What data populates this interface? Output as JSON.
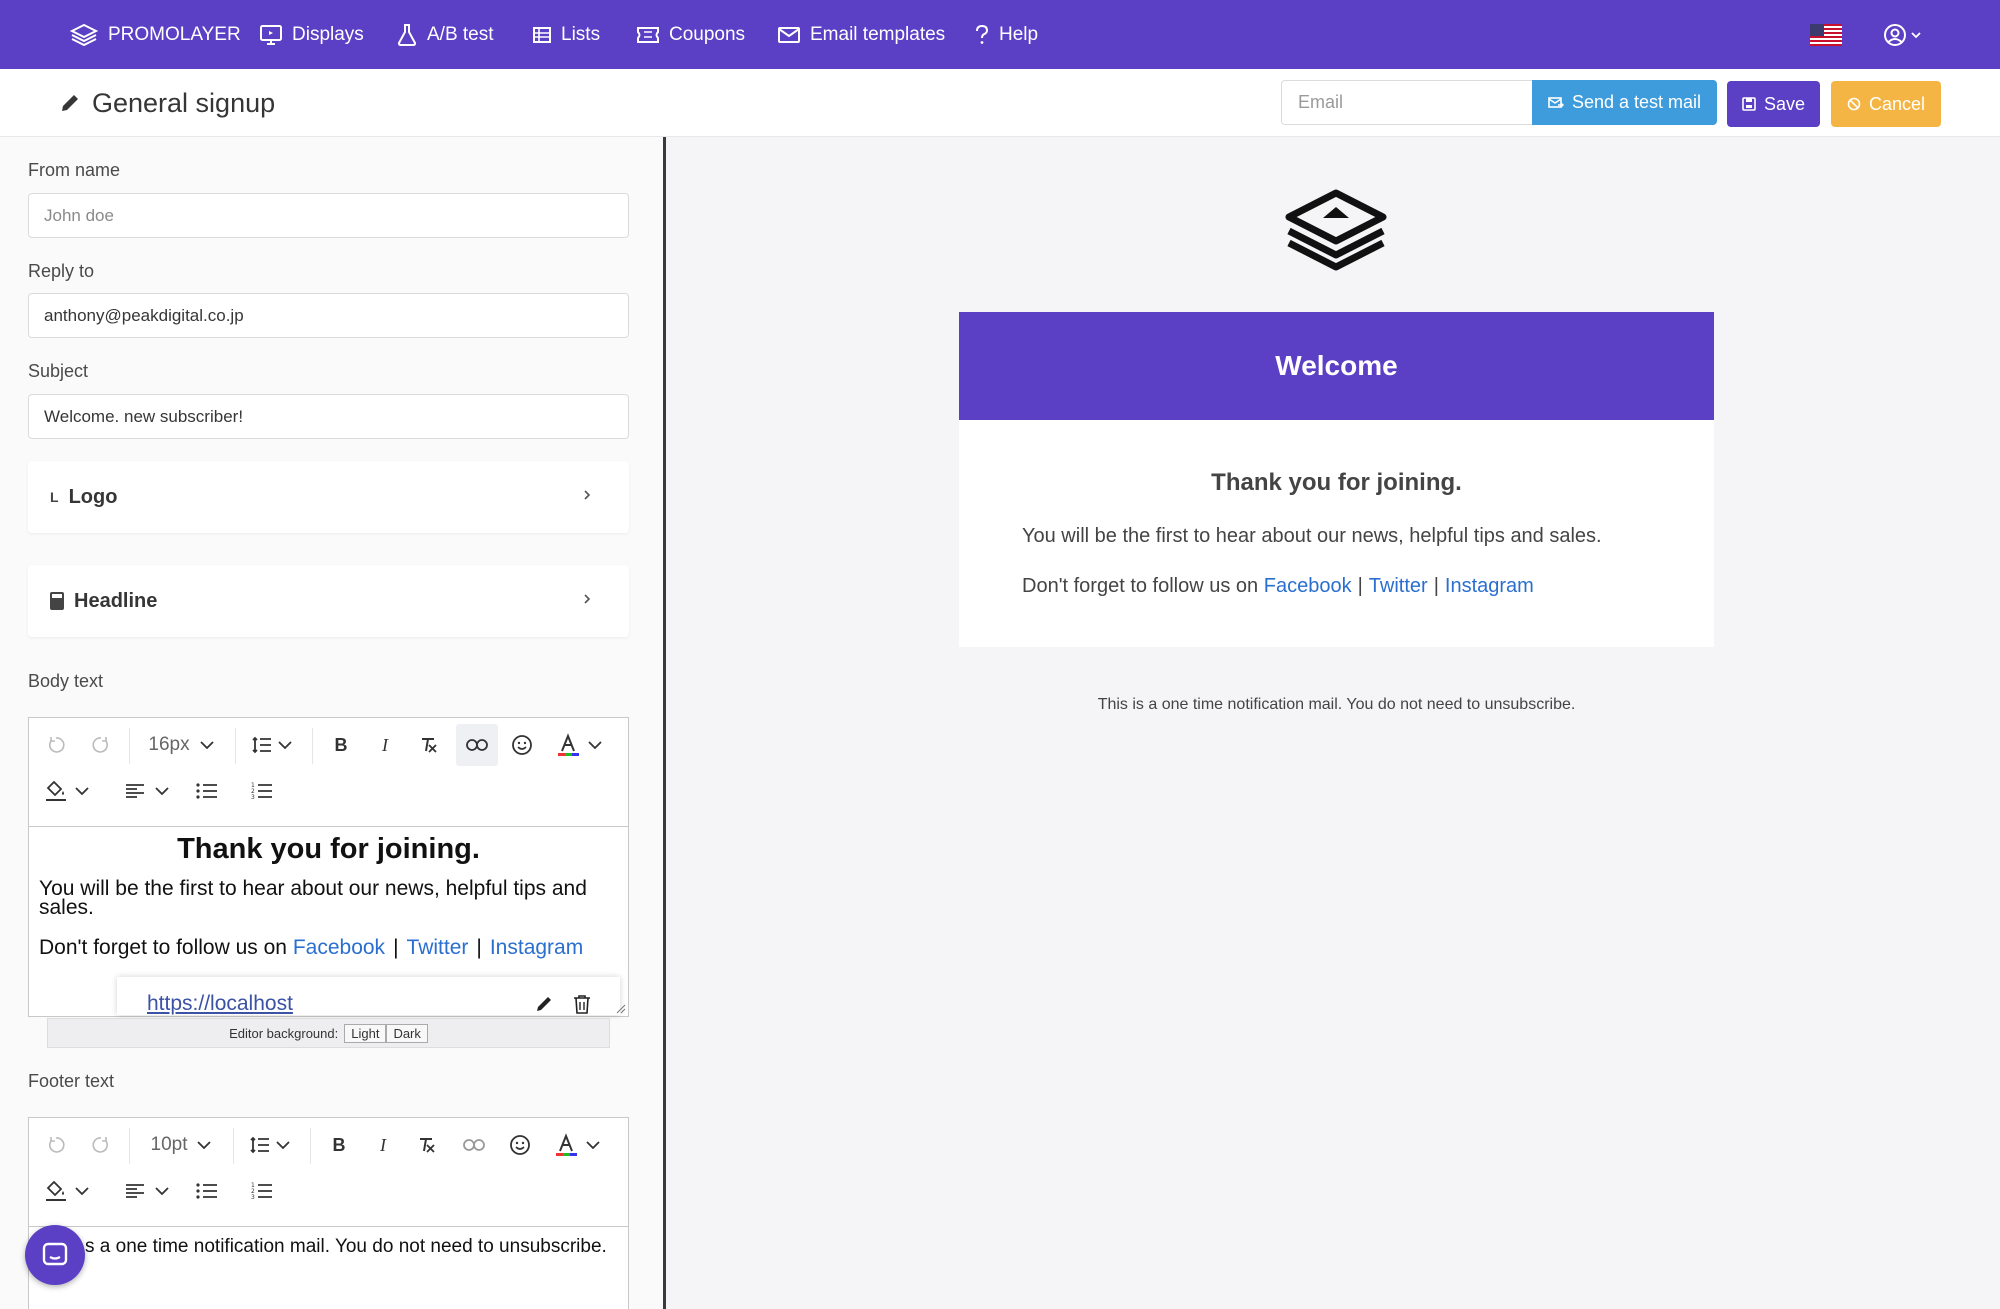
{
  "nav": {
    "brand": "PROMOLAYER",
    "items": [
      {
        "label": "Displays",
        "icon": "monitor-icon"
      },
      {
        "label": "A/B test",
        "icon": "flask-icon"
      },
      {
        "label": "Lists",
        "icon": "list-icon"
      },
      {
        "label": "Coupons",
        "icon": "ticket-icon"
      },
      {
        "label": "Email templates",
        "icon": "envelope-icon"
      },
      {
        "label": "Help",
        "icon": "question-icon"
      }
    ],
    "flag_icon": "us-flag-icon",
    "user_icon": "user-circle-icon"
  },
  "header": {
    "title": "General signup",
    "email_placeholder": "Email",
    "test_mail_label": "Send a test mail",
    "save_label": "Save",
    "cancel_label": "Cancel"
  },
  "form": {
    "from_name": {
      "label": "From name",
      "placeholder": "John doe",
      "value": ""
    },
    "reply_to": {
      "label": "Reply to",
      "value": "anthony@peakdigital.co.jp"
    },
    "subject": {
      "label": "Subject",
      "value": "Welcome. new subscriber!"
    },
    "sections": [
      {
        "label": "Logo",
        "icon": "text-l-icon"
      },
      {
        "label": "Headline",
        "icon": "calculator-icon"
      }
    ],
    "body_text": {
      "label": "Body text",
      "font_size": "16px",
      "headline": "Thank you for joining.",
      "paragraph": "You will be the first to hear about our news, helpful tips and sales.",
      "follow_prefix": "Don't forget to follow us on ",
      "links": [
        "Facebook",
        "Twitter",
        "Instagram"
      ],
      "separator": "|",
      "link_popup_url": "https://localhost",
      "editor_background_label": "Editor background:",
      "bg_light": "Light",
      "bg_dark": "Dark"
    },
    "footer_text": {
      "label": "Footer text",
      "font_size": "10pt",
      "content_visible": "s a one time notification mail. You do not need to unsubscribe."
    }
  },
  "preview": {
    "header": "Welcome",
    "headline": "Thank you for joining.",
    "paragraph": "You will be the first to hear about our news, helpful tips and sales.",
    "follow_prefix": "Don't forget to follow us on ",
    "links": [
      "Facebook",
      "Twitter",
      "Instagram"
    ],
    "separator": "|",
    "footer": "This is a one time notification mail. You do not need to unsubscribe."
  },
  "colors": {
    "brand": "#5b3fc4",
    "test_mail": "#3e9cdc",
    "cancel": "#f5b544",
    "link": "#2a6fcf"
  }
}
